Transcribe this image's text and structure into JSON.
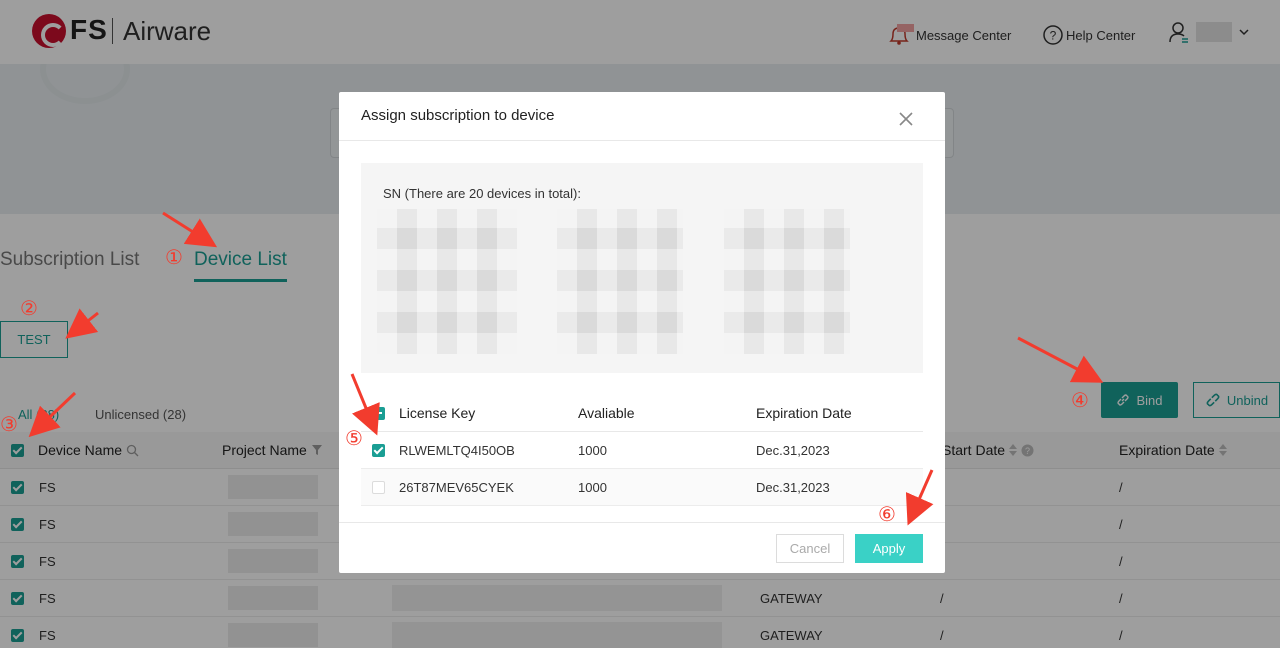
{
  "header": {
    "brand": "FS",
    "product": "Airware",
    "message_center": "Message Center",
    "help_center": "Help Center"
  },
  "tabs": {
    "subscription_list": "Subscription List",
    "device_list": "Device List"
  },
  "test_button": "TEST",
  "filters": {
    "all": "All (28)",
    "unlicensed": "Unlicensed (28)"
  },
  "actions": {
    "bind": "Bind",
    "unbind": "Unbind"
  },
  "device_table": {
    "columns": {
      "device_name": "Device Name",
      "project_name": "Project Name",
      "start_date": "Start Date",
      "expiration_date": "Expiration Date"
    },
    "rows": [
      {
        "name": "FS",
        "type": "",
        "start": "",
        "expiration": "/"
      },
      {
        "name": "FS",
        "type": "",
        "start": "",
        "expiration": "/"
      },
      {
        "name": "FS",
        "type": "",
        "start": "",
        "expiration": "/"
      },
      {
        "name": "FS",
        "type": "GATEWAY",
        "start": "/",
        "expiration": "/"
      },
      {
        "name": "FS",
        "type": "GATEWAY",
        "start": "/",
        "expiration": "/"
      }
    ]
  },
  "modal": {
    "title": "Assign subscription to device",
    "sn_label": "SN (There are 20 devices in total):",
    "columns": {
      "license_key": "License Key",
      "available": "Avaliable",
      "expiration": "Expiration Date"
    },
    "licenses": [
      {
        "key": "RLWEMLTQ4I50OB",
        "available": "1000",
        "expiration": "Dec.31,2023",
        "checked": true
      },
      {
        "key": "26T87MEV65CYEK",
        "available": "1000",
        "expiration": "Dec.31,2023",
        "checked": false
      }
    ],
    "cancel": "Cancel",
    "apply": "Apply"
  },
  "annotations": [
    "①",
    "②",
    "③",
    "④",
    "⑤",
    "⑥"
  ],
  "colors": {
    "accent": "#1a9e94",
    "apply": "#3ad1c6",
    "annotation": "#f23c2e",
    "brand_red": "#c8102e"
  }
}
